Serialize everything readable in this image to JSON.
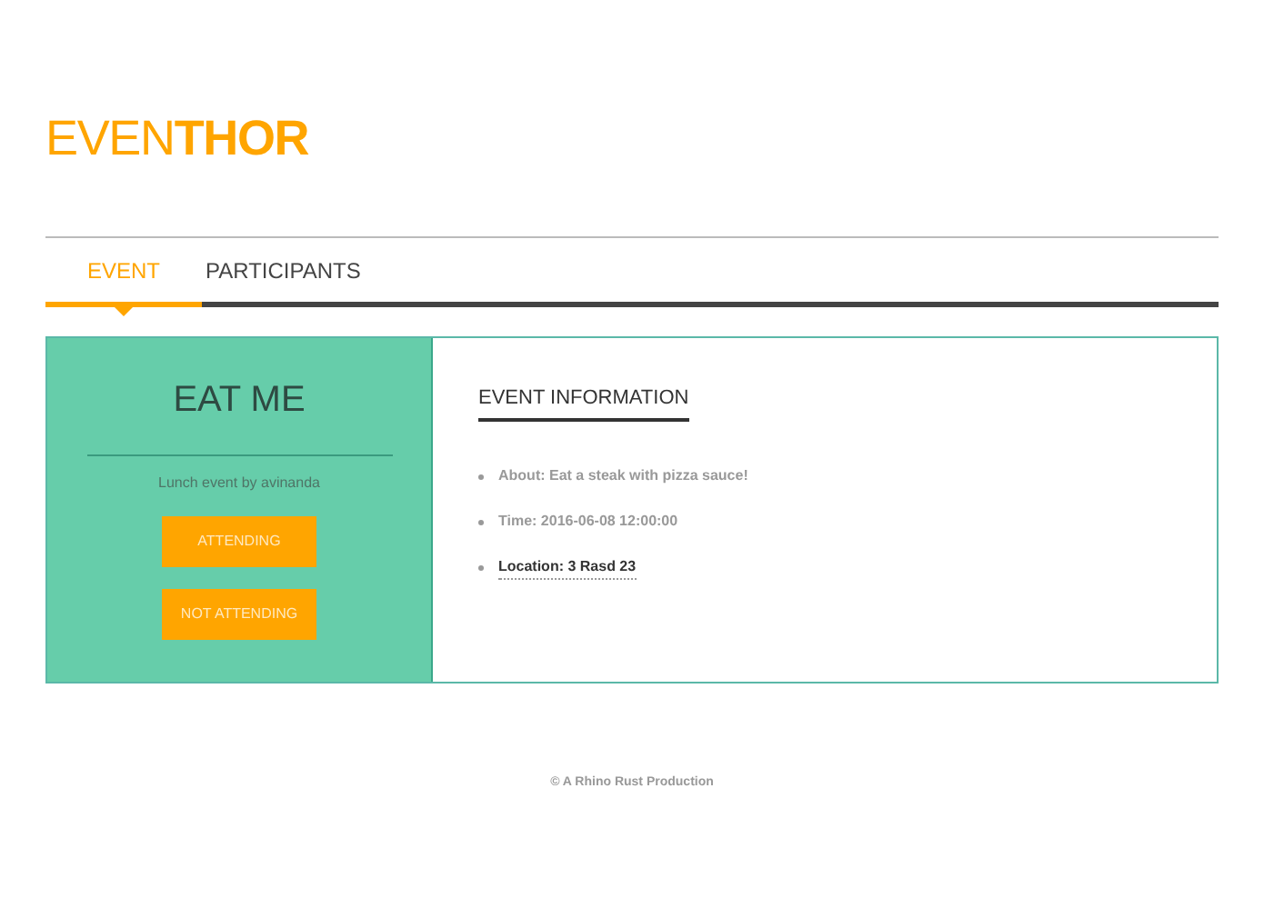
{
  "logo": "EVEN**THOR**",
  "tabs": [
    {
      "label": "EVENT",
      "selected": true
    },
    {
      "label": "PARTICIPANTS",
      "selected": false
    }
  ],
  "event": {
    "title": "EAT ME",
    "subtitle": "Lunch event by avinanda",
    "buttons": [
      "ATTENDING",
      "NOT ATTENDING"
    ]
  },
  "info": {
    "heading": "EVENT INFORMATION",
    "items": [
      {
        "kind": "text",
        "text": "About: Eat a steak with pizza sauce!"
      },
      {
        "kind": "text",
        "text": "Time: 2016-06-08 12:00:00"
      },
      {
        "kind": "link",
        "text": "Location: 3 Rasd 23"
      }
    ]
  },
  "footer": "© A Rhino Rust Production"
}
